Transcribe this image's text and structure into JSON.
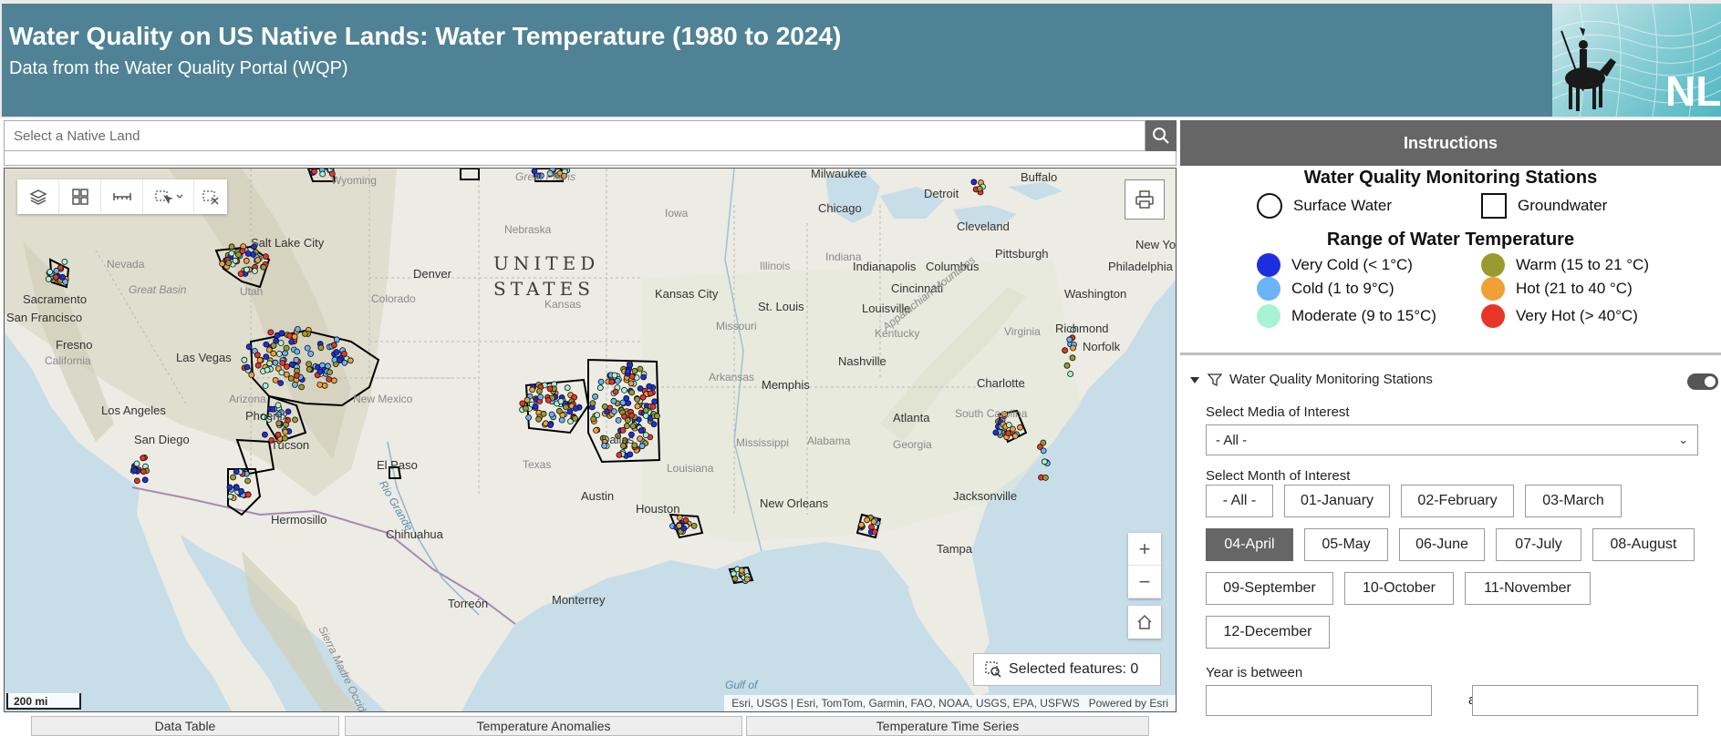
{
  "header": {
    "title": "Water Quality on US Native Lands: Water Temperature (1980 to 2024)",
    "subtitle": "Data from the Water Quality Portal (WQP)",
    "logo_text": "NLI"
  },
  "search": {
    "placeholder": "Select a Native Land",
    "icon": "search-icon"
  },
  "map": {
    "labels": {
      "country_line1": "UNITED",
      "country_line2": "STATES",
      "salt_lake_city": "Salt Lake City",
      "denver": "Denver",
      "kansas_city": "Kansas City",
      "st_louis": "St. Louis",
      "chicago": "Chicago",
      "milwaukee": "Milwaukee",
      "detroit": "Detroit",
      "cleveland": "Cleveland",
      "buffalo": "Buffalo",
      "pittsburgh": "Pittsburgh",
      "new_york": "New York",
      "philadelphia": "Philadelphia",
      "washington": "Washington",
      "richmond": "Richmond",
      "norfolk": "Norfolk",
      "indianapolis": "Indianapolis",
      "columbus": "Columbus",
      "cincinnati": "Cincinnati",
      "louisville": "Louisville",
      "nashville": "Nashville",
      "memphis": "Memphis",
      "charlotte": "Charlotte",
      "atlanta": "Atlanta",
      "jacksonville": "Jacksonville",
      "tampa": "Tampa",
      "new_orleans": "New Orleans",
      "houston": "Houston",
      "austin": "Austin",
      "dallas": "Dallas",
      "el_paso": "El Paso",
      "tucson": "Tucson",
      "phoenix": "Phoenix",
      "las_vegas": "Las Vegas",
      "los_angeles": "Los Angeles",
      "san_diego": "San Diego",
      "san_francisco": "San Francisco",
      "fresno": "Fresno",
      "sacramento": "Sacramento",
      "hermosillo": "Hermosillo",
      "chihuahua": "Chihuahua",
      "torreon": "Torreón",
      "monterrey": "Monterrey",
      "nevada": "Nevada",
      "utah": "Utah",
      "colorado": "Colorado",
      "california": "California",
      "arizona": "Arizona",
      "new_mexico": "New Mexico",
      "texas": "Texas",
      "kansas": "Kansas",
      "nebraska": "Nebraska",
      "iowa": "Iowa",
      "missouri": "Missouri",
      "arkansas": "Arkansas",
      "louisiana": "Louisiana",
      "mississippi": "Mississippi",
      "alabama": "Alabama",
      "georgia": "Georgia",
      "south_carolina": "South Carolina",
      "kentucky": "Kentucky",
      "illinois": "Illinois",
      "indiana": "Indiana",
      "virginia": "Virginia",
      "great_basin": "Great Basin",
      "appalachian_mountains": "Appalachian Mountains",
      "rio_grande": "Rio Grande",
      "gulf_of": "Gulf of",
      "sierra_madre": "Sierra Madre Occidental",
      "wyoming": "Wyoming",
      "great_plains": "Great Plains"
    },
    "scale": "200 mi",
    "attribution": "Esri, USGS | Esri, TomTom, Garmin, FAO, NOAA, USGS, EPA, USFWS",
    "powered_by": "Powered by Esri",
    "selected_features": "Selected features: 0",
    "zoom_in": "+",
    "zoom_out": "−",
    "colors": {
      "land": "#ecebe4",
      "water": "#c7dde8",
      "terrain": "#d9d6c8",
      "boundary": "#111111"
    }
  },
  "bottom_tabs": [
    "Data Table",
    "Temperature Anomalies",
    "Temperature Time Series"
  ],
  "panel": {
    "instructions": "Instructions",
    "legend": {
      "stations_title": "Water Quality Monitoring Stations",
      "surface_water": "Surface Water",
      "groundwater": "Groundwater",
      "range_title": "Range of Water Temperature",
      "ranges": [
        {
          "label": "Very Cold (< 1°C)",
          "color": "#1c2fe0"
        },
        {
          "label": "Warm (15 to 21 °C)",
          "color": "#9a9b2e"
        },
        {
          "label": "Cold (1 to 9°C)",
          "color": "#6ab4f5"
        },
        {
          "label": "Hot (21 to 40 °C)",
          "color": "#f0a035"
        },
        {
          "label": "Moderate (9 to 15°C)",
          "color": "#a7f3d4"
        },
        {
          "label": "Very Hot (> 40°C)",
          "color": "#e83528"
        }
      ]
    },
    "filter": {
      "title": "Water Quality Monitoring Stations",
      "media_label": "Select Media of Interest",
      "media_value": "- All -",
      "month_label": "Select Month of Interest",
      "months": [
        "- All -",
        "01-January",
        "02-February",
        "03-March",
        "04-April",
        "05-May",
        "06-June",
        "07-July",
        "08-August",
        "09-September",
        "10-October",
        "11-November",
        "12-December"
      ],
      "active_month": "04-April",
      "year_label": "Year is between",
      "year_and": "and"
    }
  }
}
